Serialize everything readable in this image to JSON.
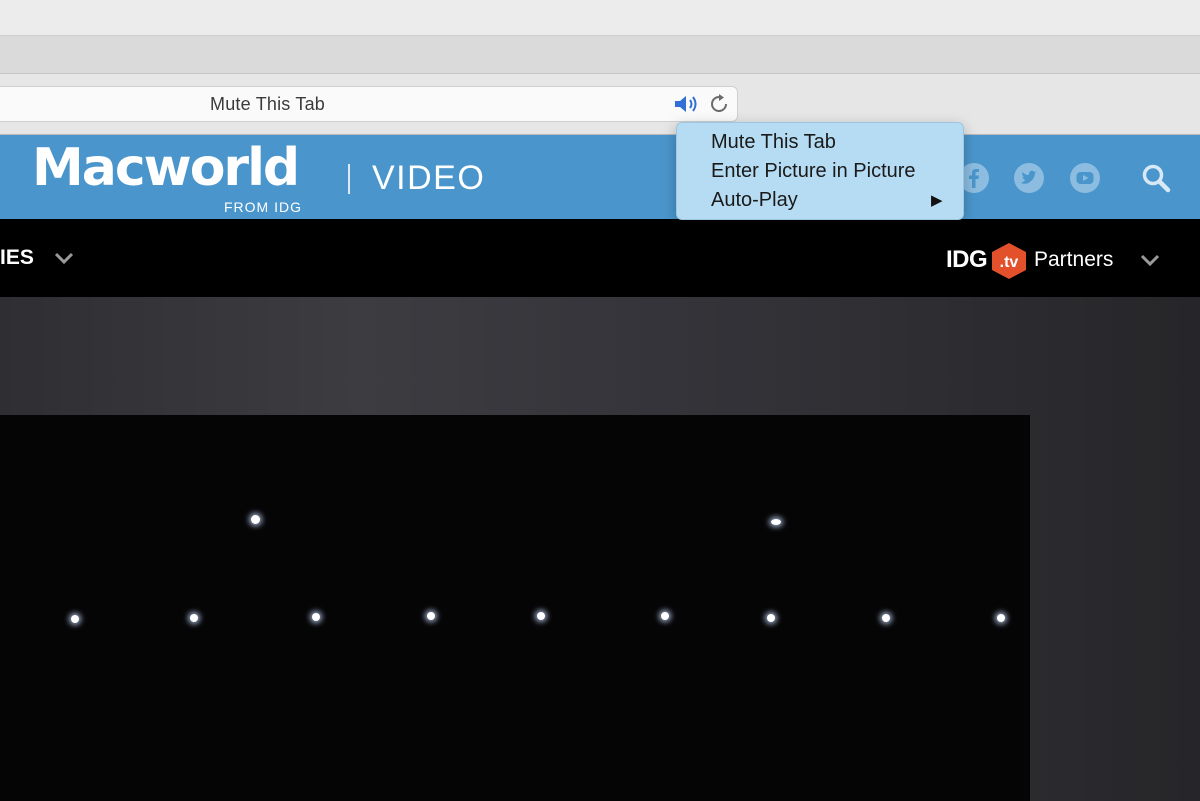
{
  "browser": {
    "address_text": "Mute This Tab",
    "audio_icon": "speaker-on-icon",
    "reload_icon": "reload-icon"
  },
  "context_menu": {
    "items": [
      {
        "label": "Mute This Tab"
      },
      {
        "label": "Enter Picture in Picture"
      },
      {
        "label": "Auto-Play",
        "has_submenu": true,
        "submenu_arrow": "▶"
      }
    ]
  },
  "site_header": {
    "logo_text": "Macworld",
    "logo_sub": "FROM IDG",
    "section_title": "VIDEO",
    "social_icons": [
      "facebook-icon",
      "twitter-icon",
      "youtube-icon"
    ],
    "search_icon": "search-icon",
    "accent_color": "#4a96cc"
  },
  "nav": {
    "category_label": "IES",
    "idg_text": "IDG",
    "idg_badge": ".tv",
    "partners_label": "Partners"
  }
}
